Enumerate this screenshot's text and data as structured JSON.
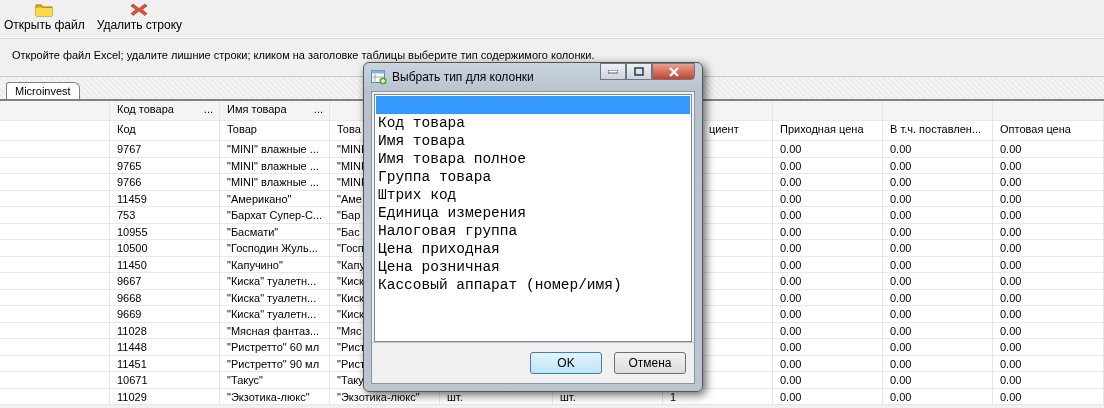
{
  "toolbar": [
    {
      "kind": "open",
      "label": "Открыть файл"
    },
    {
      "kind": "delete",
      "label": "Удалить строку"
    }
  ],
  "instruction": "Откройте файл Excel;  удалите лишние строки;  кликом на заголовке таблицы выберите тип содержимого колонки.",
  "tabs": [
    {
      "label": "Microinvest",
      "selected": true
    }
  ],
  "table": {
    "mapping_row": [
      {
        "label": "Код товара",
        "button": "..."
      },
      {
        "label": "Имя товара",
        "button": "..."
      }
    ],
    "columns": [
      "Код",
      "Товар",
      "Това",
      "",
      "",
      "циент",
      "Приходная цена",
      "В т.ч. поставлен...",
      "Оптовая цена"
    ],
    "rows": [
      {
        "cells": [
          "9767",
          "\"MINI\" влажные ...",
          "\"MINI",
          "",
          "",
          "",
          "0.00",
          "0.00",
          "0.00"
        ]
      },
      {
        "cells": [
          "9765",
          "\"MINI\" влажные ...",
          "\"MINI",
          "",
          "",
          "",
          "0.00",
          "0.00",
          "0.00"
        ]
      },
      {
        "cells": [
          "9766",
          "\"MINI\" влажные ...",
          "\"MINI",
          "",
          "",
          "",
          "0.00",
          "0.00",
          "0.00"
        ]
      },
      {
        "cells": [
          "11459",
          "\"Американо\"",
          "\"Аме",
          "",
          "",
          "",
          "0.00",
          "0.00",
          "0.00"
        ]
      },
      {
        "cells": [
          "753",
          "\"Бархат Супер-С...",
          "\"Бар",
          "",
          "",
          "",
          "0.00",
          "0.00",
          "0.00"
        ]
      },
      {
        "cells": [
          "10955",
          "\"Басмати\"",
          "\"Бас",
          "",
          "",
          "",
          "0.00",
          "0.00",
          "0.00"
        ]
      },
      {
        "cells": [
          "10500",
          "\"Господин Жуль...",
          "\"Госп",
          "",
          "",
          "",
          "0.00",
          "0.00",
          "0.00"
        ]
      },
      {
        "cells": [
          "11450",
          "\"Капучино\"",
          "\"Капу",
          "",
          "",
          "",
          "0.00",
          "0.00",
          "0.00"
        ]
      },
      {
        "cells": [
          "9667",
          "\"Киска\" туалетн...",
          "\"Киск",
          "",
          "",
          "",
          "0.00",
          "0.00",
          "0.00"
        ]
      },
      {
        "cells": [
          "9668",
          "\"Киска\" туалетн...",
          "\"Киск",
          "",
          "",
          "",
          "0.00",
          "0.00",
          "0.00"
        ]
      },
      {
        "cells": [
          "9669",
          "\"Киска\" туалетн...",
          "\"Киск",
          "",
          "",
          "",
          "0.00",
          "0.00",
          "0.00"
        ]
      },
      {
        "cells": [
          "11028",
          "\"Мясная фантаз...",
          "\"Мяс",
          "",
          "",
          "",
          "0.00",
          "0.00",
          "0.00"
        ]
      },
      {
        "cells": [
          "11448",
          "\"Ристретто\" 60 мл",
          "\"Рист",
          "",
          "",
          "",
          "0.00",
          "0.00",
          "0.00"
        ]
      },
      {
        "cells": [
          "11451",
          "\"Ристретто\" 90 мл",
          "\"Рист",
          "",
          "",
          "",
          "0.00",
          "0.00",
          "0.00"
        ]
      },
      {
        "cells": [
          "10671",
          "\"Такус\"",
          "\"Таку",
          "",
          "",
          "",
          "0.00",
          "0.00",
          "0.00"
        ]
      },
      {
        "cells": [
          "11029",
          "\"Экзотика-люкс\"",
          "\"Экзотика-люкс\"",
          "шт.",
          "шт.",
          "1",
          "0.00",
          "0.00",
          "0.00"
        ]
      }
    ]
  },
  "dialog": {
    "title": "Выбрать тип для колонки",
    "empty_choice": {
      "selected": true
    },
    "options": [
      {
        "label": "Код товара",
        "selected": false
      },
      {
        "label": "Имя товара",
        "selected": false
      },
      {
        "label": "Имя товара полное",
        "selected": false
      },
      {
        "label": "Группа товара",
        "selected": false
      },
      {
        "label": "Штрих код",
        "selected": false
      },
      {
        "label": "Единица измерения",
        "selected": false
      },
      {
        "label": "Налоговая группа",
        "selected": false
      },
      {
        "label": "Цена приходная",
        "selected": false
      },
      {
        "label": "Цена розничная",
        "selected": false
      },
      {
        "label": "Кассовый аппарат (номер/имя)",
        "selected": false
      }
    ],
    "buttons": [
      {
        "label": "OK",
        "default": true
      },
      {
        "label": "Отмена",
        "default": false
      }
    ]
  }
}
